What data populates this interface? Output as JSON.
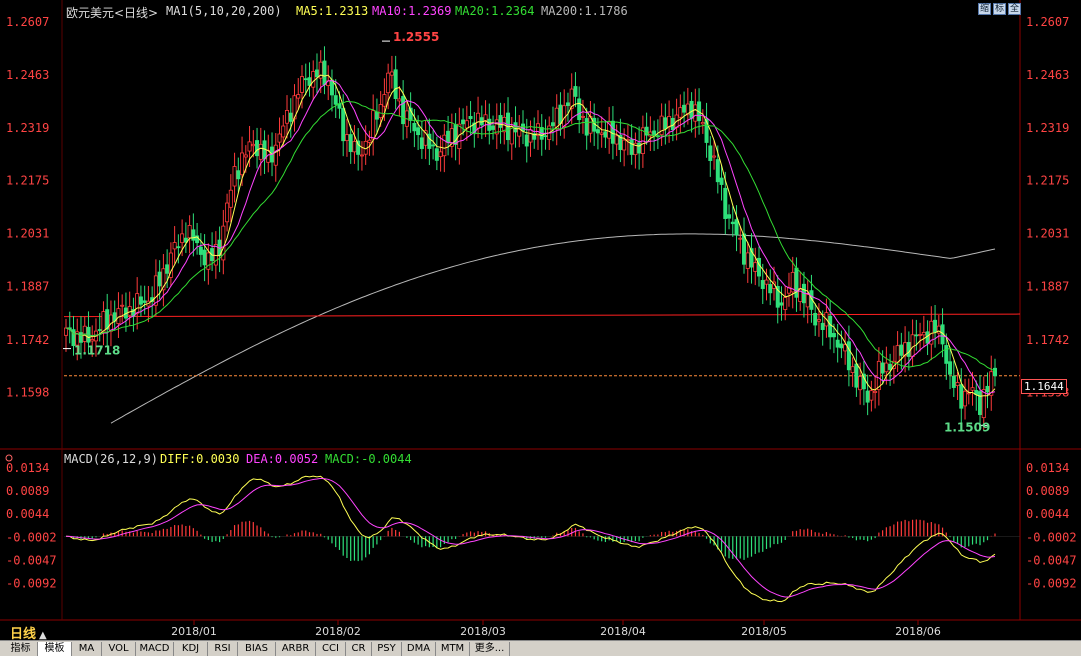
{
  "header": {
    "symbol": "欧元美元<日线>",
    "ma_indicator": "MA1(5,10,20,200)",
    "ma5": "MA5:1.2313",
    "ma10": "MA10:1.2369",
    "ma20": "MA20:1.2364",
    "ma200": "MA200:1.1786"
  },
  "macd_header": {
    "label": "MACD(26,12,9)",
    "diff": "DIFF:0.0030",
    "dea": "DEA:0.0052",
    "macd": "MACD:-0.0044"
  },
  "window_buttons": [
    "缩",
    "标",
    "全"
  ],
  "price_box": "1.1644",
  "period_label": "日线",
  "tabs": [
    {
      "label": "指标",
      "active": false
    },
    {
      "label": "模板",
      "active": true
    },
    {
      "label": "MA",
      "active": false
    },
    {
      "label": "VOL",
      "active": false
    },
    {
      "label": "MACD",
      "active": false
    },
    {
      "label": "KDJ",
      "active": false
    },
    {
      "label": "RSI",
      "active": false
    },
    {
      "label": "BIAS",
      "active": false
    },
    {
      "label": "ARBR",
      "active": false
    },
    {
      "label": "CCI",
      "active": false
    },
    {
      "label": "CR",
      "active": false
    },
    {
      "label": "PSY",
      "active": false
    },
    {
      "label": "DMA",
      "active": false
    },
    {
      "label": "MTM",
      "active": false
    },
    {
      "label": "更多...",
      "active": false
    }
  ],
  "colors": {
    "up": "#ff3b3b",
    "down": "#2ee07a",
    "ma5": "#ffff55",
    "ma10": "#ff44ff",
    "ma20": "#33dd33",
    "ma200": "#b8b8b8",
    "axis_label": "#ff4444",
    "hline": "#ff2020"
  },
  "chart_data": [
    {
      "type": "candlestick",
      "title": "欧元美元<日线>",
      "y_ticks": [
        1.2607,
        1.2463,
        1.2319,
        1.2175,
        1.2031,
        1.1887,
        1.1742,
        1.1598
      ],
      "y_tick_labels": [
        "1.2607",
        "1.2463",
        "1.2319",
        "1.2175",
        "1.2031",
        "1.1887",
        "1.1742",
        "1.1598"
      ],
      "ylim": [
        1.151,
        1.2607
      ],
      "x_tick_labels": [
        "2018/01",
        "2018/02",
        "2018/03",
        "2018/04",
        "2018/05",
        "2018/06"
      ],
      "annotations": [
        {
          "text": "1.2555",
          "value": 1.2555
        },
        {
          "text": "1.1718",
          "value": 1.1718
        },
        {
          "text": "1.1509",
          "value": 1.1509
        }
      ],
      "reference_lines": [
        {
          "kind": "trend",
          "from": 1.1805,
          "to": 1.1812
        },
        {
          "kind": "current_price",
          "value": 1.1644
        }
      ],
      "anchors": [
        [
          0,
          1.176
        ],
        [
          6,
          1.1745
        ],
        [
          12,
          1.1805
        ],
        [
          18,
          1.183
        ],
        [
          23,
          1.186
        ],
        [
          28,
          1.197
        ],
        [
          32,
          1.204
        ],
        [
          35,
          1.2
        ],
        [
          38,
          1.195
        ],
        [
          41,
          1.2
        ],
        [
          45,
          1.22
        ],
        [
          50,
          1.228
        ],
        [
          54,
          1.223
        ],
        [
          58,
          1.232
        ],
        [
          62,
          1.242
        ],
        [
          64,
          1.245
        ],
        [
          67,
          1.247
        ],
        [
          70,
          1.245
        ],
        [
          74,
          1.231
        ],
        [
          78,
          1.224
        ],
        [
          80,
          1.228
        ],
        [
          84,
          1.238
        ],
        [
          86,
          1.247
        ],
        [
          90,
          1.236
        ],
        [
          94,
          1.23
        ],
        [
          99,
          1.225
        ],
        [
          103,
          1.23
        ],
        [
          108,
          1.234
        ],
        [
          113,
          1.233
        ],
        [
          118,
          1.232
        ],
        [
          122,
          1.23
        ],
        [
          127,
          1.23
        ],
        [
          131,
          1.234
        ],
        [
          135,
          1.241
        ],
        [
          139,
          1.232
        ],
        [
          143,
          1.231
        ],
        [
          147,
          1.229
        ],
        [
          151,
          1.226
        ],
        [
          155,
          1.23
        ],
        [
          159,
          1.232
        ],
        [
          163,
          1.235
        ],
        [
          167,
          1.238
        ],
        [
          170,
          1.232
        ],
        [
          173,
          1.222
        ],
        [
          176,
          1.21
        ],
        [
          180,
          1.2
        ],
        [
          184,
          1.193
        ],
        [
          188,
          1.188
        ],
        [
          191,
          1.184
        ],
        [
          194,
          1.19
        ],
        [
          197,
          1.186
        ],
        [
          200,
          1.18
        ],
        [
          203,
          1.178
        ],
        [
          207,
          1.172
        ],
        [
          211,
          1.164
        ],
        [
          214,
          1.158
        ],
        [
          217,
          1.165
        ],
        [
          220,
          1.168
        ],
        [
          223,
          1.171
        ],
        [
          226,
          1.174
        ],
        [
          229,
          1.176
        ],
        [
          232,
          1.177
        ],
        [
          234,
          1.175
        ],
        [
          236,
          1.163
        ],
        [
          239,
          1.159
        ],
        [
          242,
          1.16
        ],
        [
          244,
          1.157
        ],
        [
          246,
          1.161
        ],
        [
          248,
          1.1644
        ]
      ],
      "ma200_start": 1.1445,
      "ma200_end": 1.1989
    },
    {
      "type": "macd",
      "title": "MACD(26,12,9)",
      "y_ticks": [
        0.0134,
        0.0089,
        0.0044,
        -0.0002,
        -0.0047,
        -0.0092
      ],
      "y_tick_labels": [
        "0.0134",
        "0.0089",
        "0.0044",
        "-0.0002",
        "-0.0047",
        "-0.0092"
      ],
      "ylim": [
        -0.0115,
        0.0134
      ],
      "series": [
        {
          "name": "DIFF",
          "value": 0.003
        },
        {
          "name": "DEA",
          "value": 0.0052
        },
        {
          "name": "MACD",
          "value": -0.0044
        }
      ]
    }
  ]
}
